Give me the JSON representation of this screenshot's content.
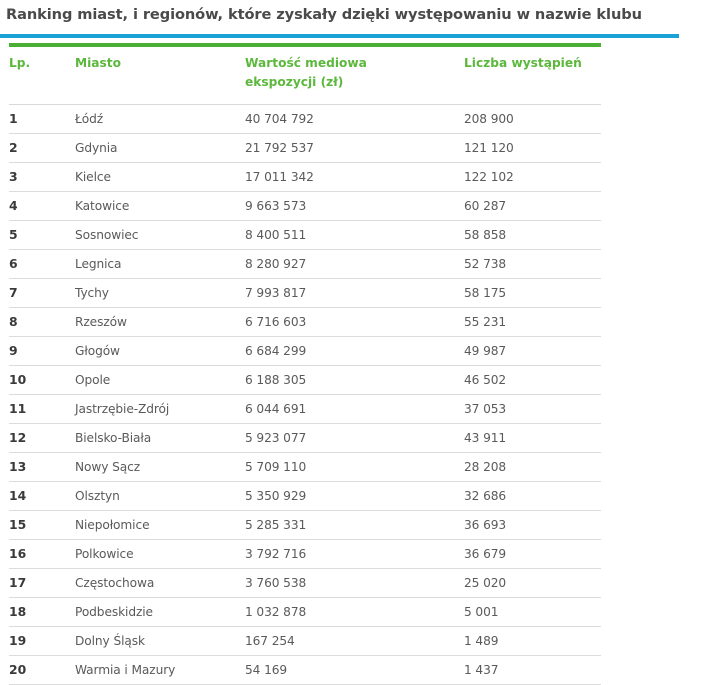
{
  "title": "Ranking miast, i regionów, które zyskały dzięki występowaniu w nazwie klubu",
  "colors": {
    "title_rule": "#1aa1d6",
    "table_rule": "#4caf35",
    "header_text": "#5cb83c"
  },
  "table": {
    "headers": {
      "lp": "Lp.",
      "city": "Miasto",
      "value_line1": "Wartość mediowa",
      "value_line2": "ekspozycji (zł)",
      "count": "Liczba wystąpień"
    },
    "rows": [
      {
        "lp": "1",
        "city": "Łódź",
        "value": "40 704 792",
        "count": "208 900"
      },
      {
        "lp": "2",
        "city": "Gdynia",
        "value": "21 792 537",
        "count": "121 120"
      },
      {
        "lp": "3",
        "city": "Kielce",
        "value": "17 011 342",
        "count": "122 102"
      },
      {
        "lp": "4",
        "city": "Katowice",
        "value": "9 663 573",
        "count": "60 287"
      },
      {
        "lp": "5",
        "city": "Sosnowiec",
        "value": "8 400 511",
        "count": "58 858"
      },
      {
        "lp": "6",
        "city": "Legnica",
        "value": "8 280 927",
        "count": "52 738"
      },
      {
        "lp": "7",
        "city": "Tychy",
        "value": "7 993 817",
        "count": "58 175"
      },
      {
        "lp": "8",
        "city": "Rzeszów",
        "value": "6 716 603",
        "count": "55 231"
      },
      {
        "lp": "9",
        "city": "Głogów",
        "value": "6 684 299",
        "count": "49 987"
      },
      {
        "lp": "10",
        "city": "Opole",
        "value": "6 188 305",
        "count": "46 502"
      },
      {
        "lp": "11",
        "city": "Jastrzębie-Zdrój",
        "value": "6 044 691",
        "count": "37 053"
      },
      {
        "lp": "12",
        "city": "Bielsko-Biała",
        "value": "5 923 077",
        "count": "43 911"
      },
      {
        "lp": "13",
        "city": "Nowy Sącz",
        "value": "5 709 110",
        "count": "28 208"
      },
      {
        "lp": "14",
        "city": "Olsztyn",
        "value": "5 350 929",
        "count": "32 686"
      },
      {
        "lp": "15",
        "city": "Niepołomice",
        "value": "5 285 331",
        "count": "36 693"
      },
      {
        "lp": "16",
        "city": "Polkowice",
        "value": "3 792 716",
        "count": "36 679"
      },
      {
        "lp": "17",
        "city": "Częstochowa",
        "value": "3 760 538",
        "count": "25 020"
      },
      {
        "lp": "18",
        "city": "Podbeskidzie",
        "value": "1 032 878",
        "count": "5 001"
      },
      {
        "lp": "19",
        "city": "Dolny Śląsk",
        "value": "167 254",
        "count": "1 489"
      },
      {
        "lp": "20",
        "city": "Warmia i Mazury",
        "value": "54 169",
        "count": "1 437"
      }
    ]
  }
}
